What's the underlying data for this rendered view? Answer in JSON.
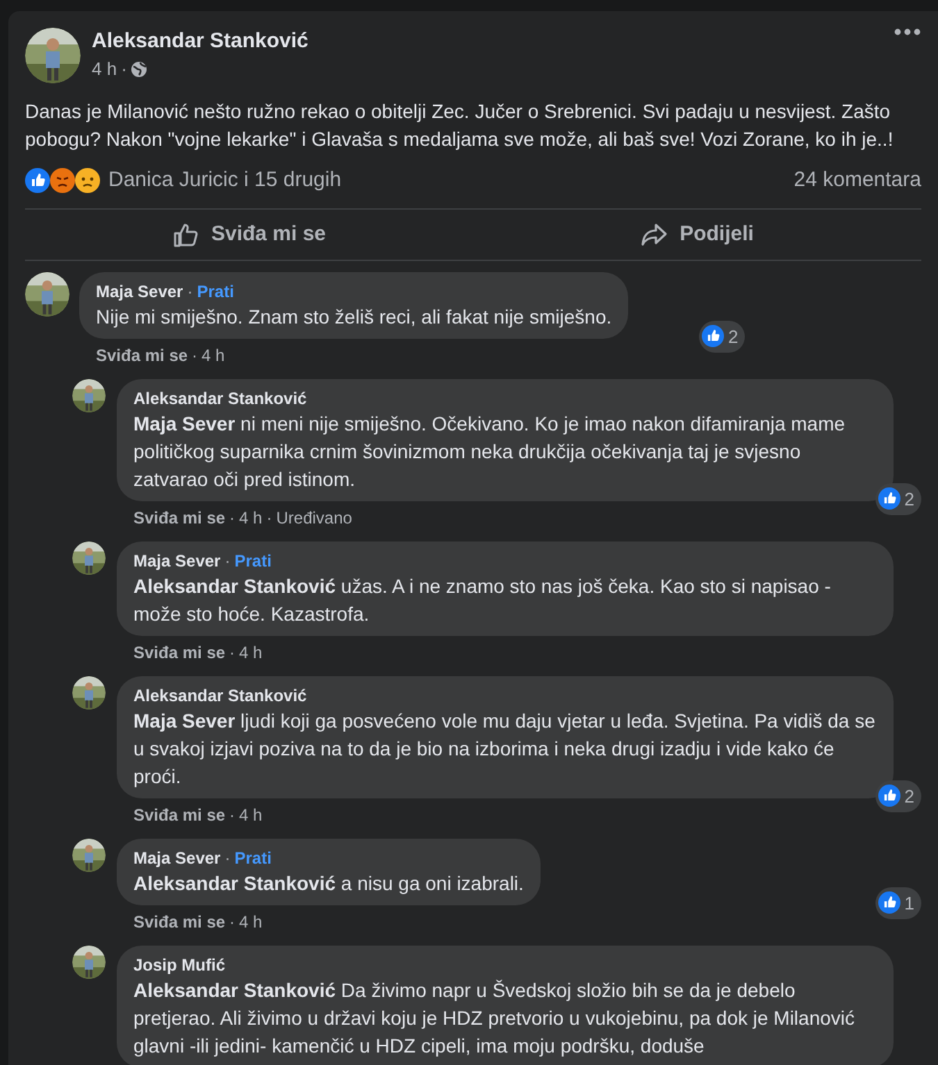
{
  "post": {
    "author": "Aleksandar Stanković",
    "time": "4 h",
    "separator": "·",
    "text": "Danas je Milanović nešto ružno rekao o obitelji Zec. Jučer o Srebrenici. Svi padaju u nesvijest. Zašto pobogu? Nakon \"vojne lekarke\" i Glavaša s medaljama sve može, ali baš sve! Vozi Zorane, ko ih je..!",
    "reactions": "Danica Juricic i 15 drugih",
    "comment_count": "24 komentara",
    "actions": [
      {
        "kind": "like",
        "label": "Sviđa mi se"
      },
      {
        "kind": "share",
        "label": "Podijeli"
      }
    ]
  },
  "comments": [
    {
      "author": "Maja Sever",
      "separator": "·",
      "follow": "Prati",
      "text": "Nije mi smiješno. Znam sto želiš reci, ali fakat nije smiješno.",
      "likes": "2",
      "like_label": "Sviđa mi se",
      "time": "4 h",
      "replies": [
        {
          "author": "Aleksandar Stanković",
          "separator": "·",
          "text": "**Maja Sever** ni meni nije smiješno. Očekivano. Ko je imao nakon difamiranja mame političkog suparnika crnim šovinizmom neka drukčija očekivanja taj je svjesno zatvarao oči pred istinom.",
          "likes": "2",
          "like_label": "Sviđa mi se",
          "time": "4 h",
          "edited": "Uređivano"
        },
        {
          "author": "Maja Sever",
          "separator": "·",
          "follow": "Prati",
          "text": "**Aleksandar Stanković** užas. A i ne znamo sto nas još čeka. Kao sto si napisao - može sto hoće. Kazastrofa.",
          "like_label": "Sviđa mi se",
          "time": "4 h"
        },
        {
          "author": "Aleksandar Stanković",
          "separator": "·",
          "text": "**Maja Sever** ljudi koji ga posvećeno vole mu daju vjetar u leđa. Svjetina. Pa vidiš da se u svakoj izjavi poziva na to da je bio na izborima i neka drugi izadju i vide kako će proći.",
          "likes": "2",
          "like_label": "Sviđa mi se",
          "time": "4 h"
        },
        {
          "author": "Maja Sever",
          "separator": "·",
          "follow": "Prati",
          "text": "**Aleksandar Stanković** a nisu ga oni izabrali.",
          "likes": "1",
          "like_label": "Sviđa mi se",
          "time": "4 h"
        },
        {
          "author": "Josip Mufić",
          "text": "**Aleksandar Stanković** Da živimo napr u Švedskoj složio bih se da je debelo pretjerao. Ali živimo u državi koju je HDZ pretvorio u vukojebinu, pa dok je Milanović glavni -ili jedini- kamenčić u HDZ cipeli, ima moju podršku, doduše"
        }
      ]
    }
  ]
}
